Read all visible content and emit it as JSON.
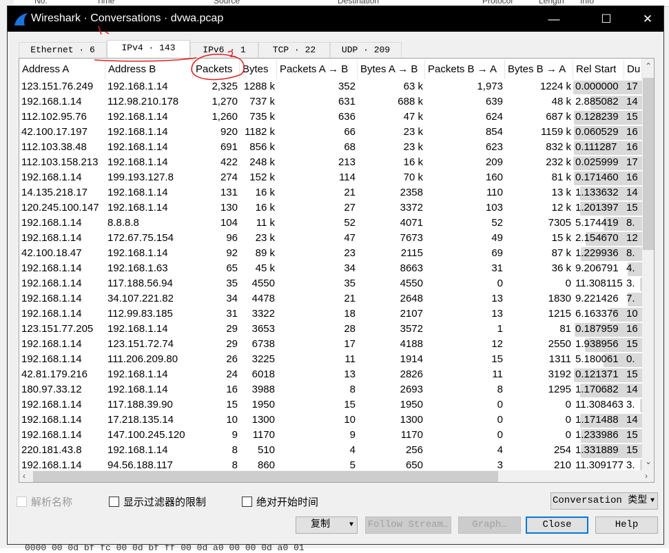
{
  "background": {
    "columns": [
      "No.",
      "Time",
      "Source",
      "Destination",
      "Protocol",
      "Length",
      "Info"
    ],
    "hex": "0000  00 0d bf fc 00 0d bf ff  00 0d a0 00 00 0d a0 01"
  },
  "window": {
    "title": "Wireshark · Conversations · dvwa.pcap",
    "minimize": "—",
    "maximize": "☐",
    "close": "✕"
  },
  "tabs": [
    {
      "label": "Ethernet · 6"
    },
    {
      "label": "IPv4 · 143",
      "active": true
    },
    {
      "label": "IPv6 · 1"
    },
    {
      "label": "TCP · 22"
    },
    {
      "label": "UDP · 209"
    }
  ],
  "table": {
    "columns": [
      "Address A",
      "Address B",
      "Packets",
      "Bytes",
      "Packets A → B",
      "Bytes A → B",
      "Packets B → A",
      "Bytes B → A",
      "Rel Start",
      "Du"
    ],
    "sort_column": "Packets",
    "sort_order": "descending",
    "rows": [
      [
        "123.151.76.249",
        "192.168.1.14",
        "2,325",
        "1288 k",
        "352",
        "63 k",
        "1,973",
        "1224 k",
        "0.000000",
        "17"
      ],
      [
        "192.168.1.14",
        "112.98.210.178",
        "1,270",
        "737 k",
        "631",
        "688 k",
        "639",
        "48 k",
        "2.885082",
        "14"
      ],
      [
        "112.102.95.76",
        "192.168.1.14",
        "1,260",
        "735 k",
        "636",
        "47 k",
        "624",
        "687 k",
        "0.128239",
        "15"
      ],
      [
        "42.100.17.197",
        "192.168.1.14",
        "920",
        "1182 k",
        "66",
        "23 k",
        "854",
        "1159 k",
        "0.060529",
        "16"
      ],
      [
        "112.103.38.48",
        "192.168.1.14",
        "691",
        "856 k",
        "68",
        "23 k",
        "623",
        "832 k",
        "0.111287",
        "16"
      ],
      [
        "112.103.158.213",
        "192.168.1.14",
        "422",
        "248 k",
        "213",
        "16 k",
        "209",
        "232 k",
        "0.025999",
        "17"
      ],
      [
        "192.168.1.14",
        "199.193.127.8",
        "274",
        "152 k",
        "114",
        "70 k",
        "160",
        "81 k",
        "0.171460",
        "16"
      ],
      [
        "14.135.218.17",
        "192.168.1.14",
        "131",
        "16 k",
        "21",
        "2358",
        "110",
        "13 k",
        "1.133632",
        "14"
      ],
      [
        "120.245.100.147",
        "192.168.1.14",
        "130",
        "16 k",
        "27",
        "3372",
        "103",
        "12 k",
        "1.201397",
        "15"
      ],
      [
        "192.168.1.14",
        "8.8.8.8",
        "104",
        "11 k",
        "52",
        "4071",
        "52",
        "7305",
        "5.174419",
        "8."
      ],
      [
        "192.168.1.14",
        "172.67.75.154",
        "96",
        "23 k",
        "47",
        "7673",
        "49",
        "15 k",
        "2.154670",
        "12"
      ],
      [
        "42.100.18.47",
        "192.168.1.14",
        "92",
        "89 k",
        "23",
        "2115",
        "69",
        "87 k",
        "1.229936",
        "8."
      ],
      [
        "192.168.1.14",
        "192.168.1.63",
        "65",
        "45 k",
        "34",
        "8663",
        "31",
        "36 k",
        "9.206791",
        "4."
      ],
      [
        "192.168.1.14",
        "117.188.56.94",
        "35",
        "4550",
        "35",
        "4550",
        "0",
        "0",
        "11.308115",
        "3."
      ],
      [
        "192.168.1.14",
        "34.107.221.82",
        "34",
        "4478",
        "21",
        "2648",
        "13",
        "1830",
        "9.221426",
        "7."
      ],
      [
        "192.168.1.14",
        "112.99.83.185",
        "31",
        "3322",
        "18",
        "2107",
        "13",
        "1215",
        "6.163376",
        "10"
      ],
      [
        "123.151.77.205",
        "192.168.1.14",
        "29",
        "3653",
        "28",
        "3572",
        "1",
        "81",
        "0.187959",
        "16"
      ],
      [
        "192.168.1.14",
        "123.151.72.74",
        "29",
        "6738",
        "17",
        "4188",
        "12",
        "2550",
        "1.938956",
        "15"
      ],
      [
        "192.168.1.14",
        "111.206.209.80",
        "26",
        "3225",
        "11",
        "1914",
        "15",
        "1311",
        "5.180061",
        "0."
      ],
      [
        "42.81.179.216",
        "192.168.1.14",
        "24",
        "6018",
        "13",
        "2826",
        "11",
        "3192",
        "0.121371",
        "15"
      ],
      [
        "180.97.33.12",
        "192.168.1.14",
        "16",
        "3988",
        "8",
        "2693",
        "8",
        "1295",
        "1.170682",
        "14"
      ],
      [
        "192.168.1.14",
        "117.188.39.90",
        "15",
        "1950",
        "15",
        "1950",
        "0",
        "0",
        "11.308463",
        "3."
      ],
      [
        "192.168.1.14",
        "17.218.135.14",
        "10",
        "1300",
        "10",
        "1300",
        "0",
        "0",
        "1.171488",
        "14"
      ],
      [
        "192.168.1.14",
        "147.100.245.120",
        "9",
        "1170",
        "9",
        "1170",
        "0",
        "0",
        "1.233986",
        "15"
      ],
      [
        "220.181.43.8",
        "192.168.1.14",
        "8",
        "510",
        "4",
        "256",
        "4",
        "254",
        "1.331889",
        "15"
      ],
      [
        "192.168.1.14",
        "94.56.188.117",
        "8",
        "860",
        "5",
        "650",
        "3",
        "210",
        "11.309177",
        "3."
      ]
    ]
  },
  "options": {
    "name_resolution": "解析名称",
    "limit_to_filter": "显示过滤器的限制",
    "absolute_start": "绝对开始时间",
    "conversation_type": "Conversation 类型"
  },
  "buttons": {
    "copy": "复制",
    "follow_stream": "Follow Stream…",
    "graph": "Graph…",
    "close": "Close",
    "help": "Help"
  },
  "colors": {
    "titlebar": "#000000",
    "default_button_border": "#0078d7",
    "timeline_bar": "#d9d9d9",
    "annotation_pen": "#e02020"
  }
}
